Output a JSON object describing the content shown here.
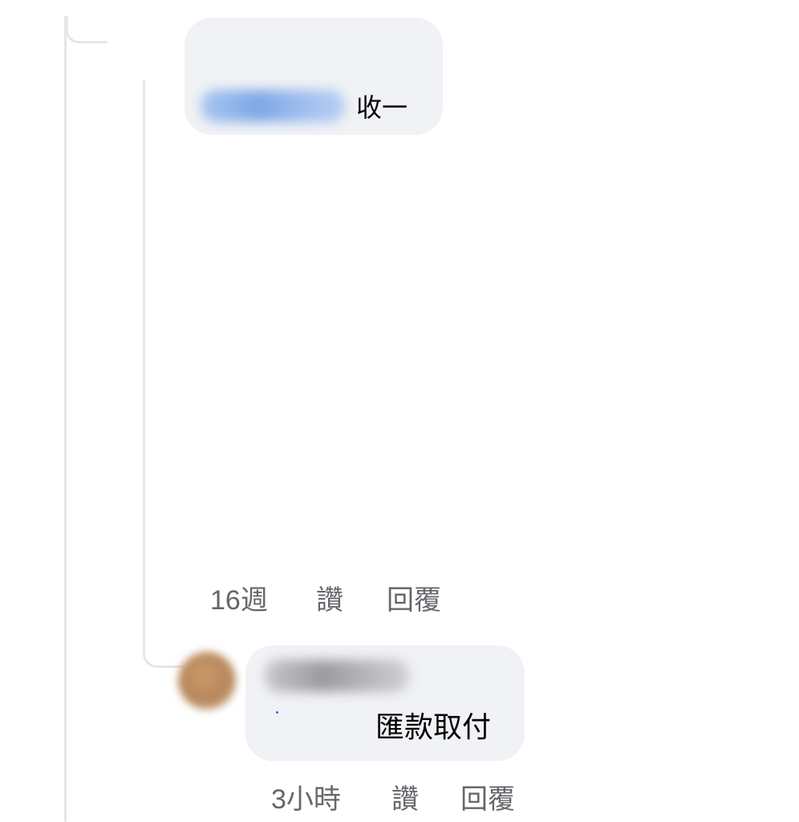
{
  "comment_1": {
    "mention_name": "Kuihao",
    "text": "收一",
    "timestamp": "16週",
    "like_label": "讚",
    "reply_label": "回覆"
  },
  "comment_2": {
    "author_name": "Kuihao",
    "text": "匯款取付",
    "timestamp": "3小時",
    "like_label": "讚",
    "reply_label": "回覆"
  },
  "colors": {
    "bubble_bg": "#f0f2f5",
    "meta_text": "#65676b",
    "thread_line": "#e4e6eb",
    "mention_blue": "#7ea7e6"
  }
}
